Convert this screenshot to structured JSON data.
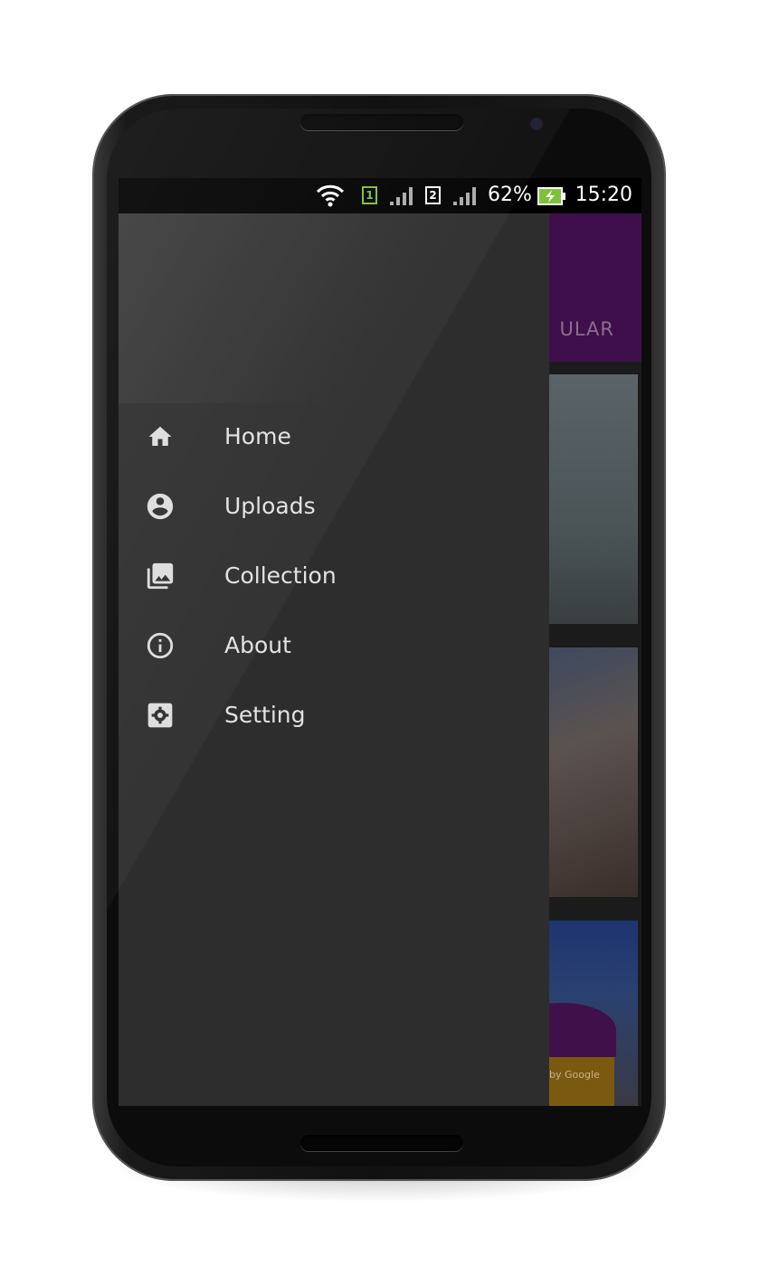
{
  "status_bar": {
    "signal_1_sim": "1",
    "signal_2_sim": "2",
    "battery": "62%",
    "time": "15:20",
    "sim1_color": "#7bc23a"
  },
  "background_app": {
    "tab_label": "ULAR",
    "toolbar_color": "#3e0f4a",
    "watermark_text": "by Google"
  },
  "drawer": {
    "items": [
      {
        "label": "Home",
        "icon": "home-icon"
      },
      {
        "label": "Uploads",
        "icon": "account-circle-icon"
      },
      {
        "label": "Collection",
        "icon": "photo-library-icon"
      },
      {
        "label": "About",
        "icon": "info-icon"
      },
      {
        "label": "Setting",
        "icon": "settings-icon"
      }
    ]
  }
}
